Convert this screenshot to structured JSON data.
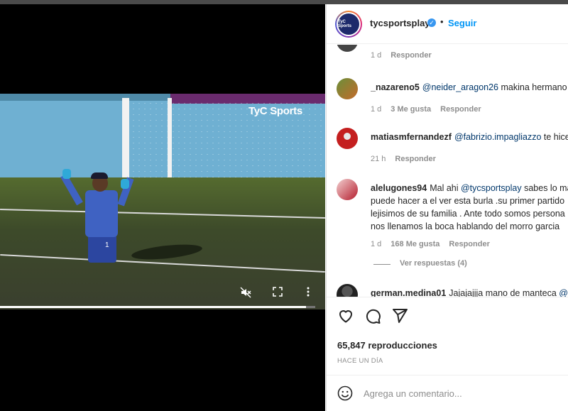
{
  "video": {
    "watermark": "TyC Sports",
    "jersey_number": "1",
    "controls": {
      "mute_icon": "muted-speaker-icon",
      "fullscreen_icon": "fullscreen-icon",
      "more_icon": "more-vertical-icon"
    },
    "progress": 0.97
  },
  "post": {
    "account": "tycsportsplay",
    "avatar_label": "TyC Sports",
    "separator": "•",
    "follow_label": "Seguir",
    "verified_icon": "verified-badge-icon"
  },
  "comments": [
    {
      "user": "",
      "text": "",
      "time": "1 d",
      "likes": "",
      "reply": "Responder"
    },
    {
      "user": "_nazareno5",
      "mention": "@neider_aragon26",
      "text": " makina hermano",
      "time": "1 d",
      "likes": "3 Me gusta",
      "reply": "Responder"
    },
    {
      "user": "matiasmfernandezf",
      "mention": "@fabrizio.impagliazzo",
      "text": " te hice",
      "time": "21 h",
      "likes": "",
      "reply": "Responder"
    },
    {
      "user": "alelugones94",
      "line1_prefix": "Mal ahi ",
      "mention": "@tycsportsplay",
      "line1_suffix": " sabes lo mal q",
      "line2": "puede hacer a el ver esta burla .su primer partido",
      "line3": "lejisimos de su familia . Ante todo somos persona",
      "line4": "nos llenamos la boca hablando del morro garcia",
      "time": "1 d",
      "likes": "168 Me gusta",
      "reply": "Responder"
    },
    {
      "user": "german.medina01",
      "text": "Jajajajjja mano de manteca",
      "mention": "@",
      "time": "",
      "likes": "",
      "reply": ""
    }
  ],
  "view_replies": "Ver respuestas (4)",
  "actions": {
    "like_icon": "heart-icon",
    "comment_icon": "comment-icon",
    "share_icon": "send-icon"
  },
  "views": "65,847 reproducciones",
  "when": "HACE UN DÍA",
  "composer": {
    "emoji_icon": "emoji-icon",
    "placeholder": "Agrega un comentario..."
  }
}
